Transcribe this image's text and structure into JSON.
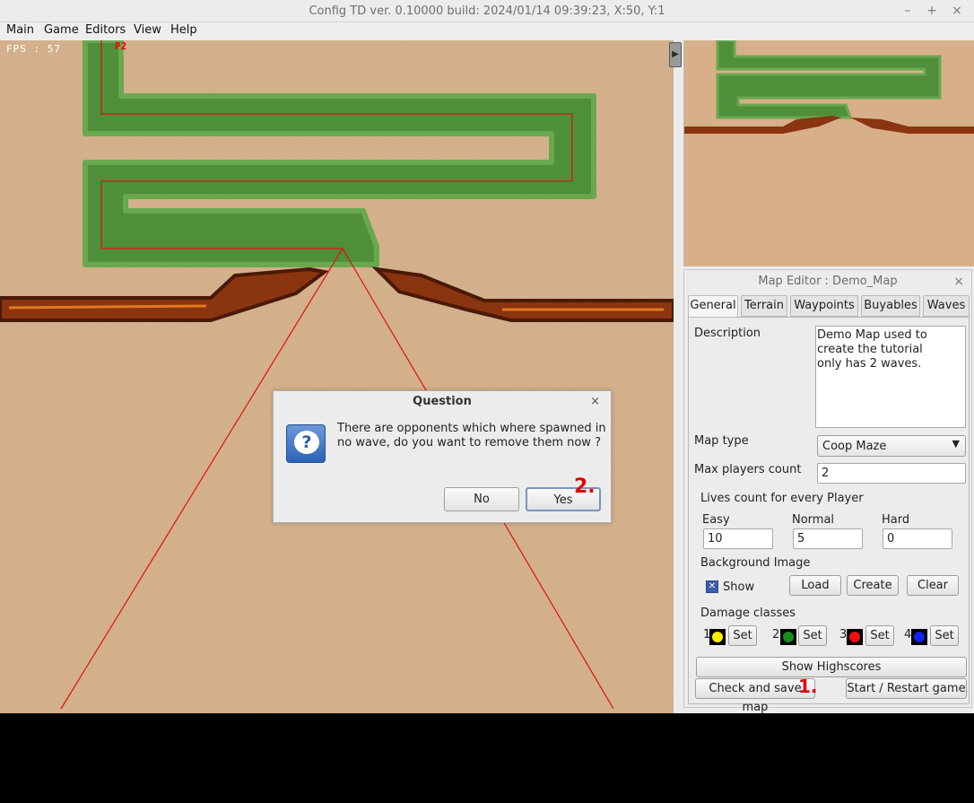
{
  "window": {
    "title": "Config TD ver. 0.10000 build: 2024/01/14  09:39:23, X:50, Y:1",
    "controls": [
      "–",
      "+",
      "×"
    ]
  },
  "menu": [
    "Main",
    "Game",
    "Editors",
    "View",
    "Help"
  ],
  "game": {
    "fps_text": "FPS : 57",
    "player_marker": "P2"
  },
  "sidebar": {
    "collapse_icon": "▶"
  },
  "editor": {
    "title": "Map Editor : Demo_Map",
    "close": "×",
    "tabs": [
      "General",
      "Terrain",
      "Waypoints",
      "Buyables",
      "Waves"
    ],
    "active_tab": "General",
    "description_label": "Description",
    "description_value": "Demo Map used to\ncreate the tutorial\nonly has 2 waves.",
    "map_type_label": "Map type",
    "map_type_value": "Coop Maze",
    "max_players_label": "Max players count",
    "max_players_value": "2",
    "lives_label": "Lives count for every Player",
    "lives": [
      {
        "label": "Easy",
        "value": "10"
      },
      {
        "label": "Normal",
        "value": "5"
      },
      {
        "label": "Hard",
        "value": "0"
      }
    ],
    "bg_image_label": "Background Image",
    "show_label": "Show",
    "show_checked": true,
    "bg_buttons": [
      "Load",
      "Create",
      "Clear"
    ],
    "damage_label": "Damage classes",
    "damage_classes": [
      {
        "num": "1",
        "color": "#ffee00",
        "set": "Set"
      },
      {
        "num": "2",
        "color": "#1a8c1a",
        "set": "Set"
      },
      {
        "num": "3",
        "color": "#ee1111",
        "set": "Set"
      },
      {
        "num": "4",
        "color": "#1122ee",
        "set": "Set"
      }
    ],
    "show_highscores": "Show Highscores",
    "check_save": "Check and save map",
    "start_restart": "Start / Restart game"
  },
  "dialog": {
    "title": "Question",
    "close": "×",
    "message": "There are opponents which where spawned in no wave, do you want to remove them now ?",
    "no": "No",
    "yes": "Yes"
  },
  "annotations": {
    "step_one": "1.",
    "step_two": "2."
  },
  "colors": {
    "sand": "#d9b48d",
    "grass": "#4f8f3a",
    "path_line": "#e01010",
    "annotation": "#e00000"
  }
}
